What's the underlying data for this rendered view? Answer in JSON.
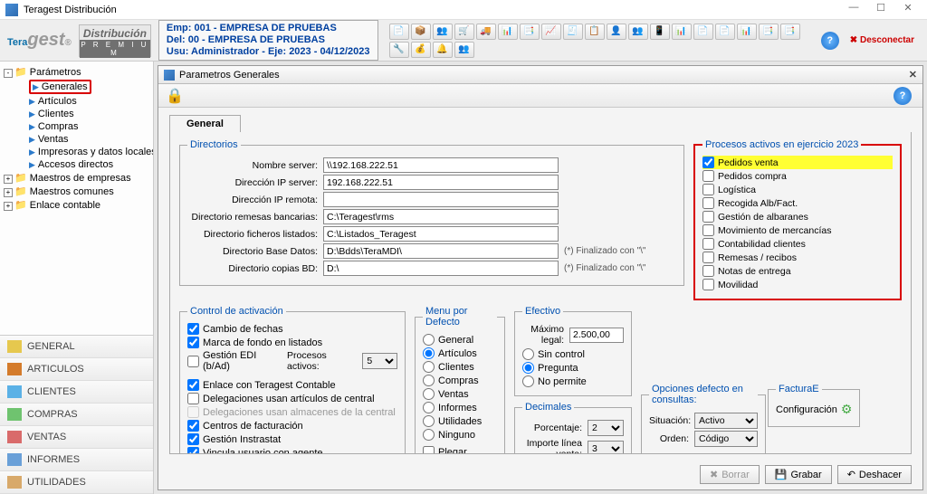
{
  "window": {
    "title": "Teragest Distribución"
  },
  "brand": {
    "main": "Tera",
    "suffix": "gest",
    "reg": "®",
    "dist": "Distribución",
    "premium": "P R E M I U M"
  },
  "info": {
    "emp": "Emp:  001 - EMPRESA DE PRUEBAS",
    "del": "Del:   00 - EMPRESA DE PRUEBAS",
    "usu": "Usu:  Administrador  - Eje:  2023 - 04/12/2023"
  },
  "disconnect": "Desconectar",
  "tree": {
    "root": "Parámetros",
    "children": [
      "Generales",
      "Artículos",
      "Clientes",
      "Compras",
      "Ventas",
      "Impresoras y datos locales",
      "Accesos directos"
    ],
    "sib1": "Maestros de empresas",
    "sib2": "Maestros comunes",
    "sib3": "Enlace contable"
  },
  "nav": [
    "GENERAL",
    "ARTICULOS",
    "CLIENTES",
    "COMPRAS",
    "VENTAS",
    "INFORMES",
    "UTILIDADES"
  ],
  "panel": {
    "title": "Parametros Generales",
    "tab": "General"
  },
  "dirs": {
    "legend": "Directorios",
    "labels": {
      "server": "Nombre server:",
      "ipserver": "Dirección IP server:",
      "ipremota": "Dirección IP remota:",
      "remesas": "Directorio remesas bancarias:",
      "listados": "Directorio ficheros listados:",
      "basedatos": "Directorio Base Datos:",
      "copias": "Directorio copias BD:"
    },
    "values": {
      "server": "\\\\192.168.222.51",
      "ipserver": "192.168.222.51",
      "ipremota": "",
      "remesas": "C:\\Teragest\\rms",
      "listados": "C:\\Listados_Teragest",
      "basedatos": "D:\\Bdds\\TeraMDI\\",
      "copias": "D:\\"
    },
    "suffix": "(*) Finalizado con \"\\\""
  },
  "control": {
    "legend": "Control de activación",
    "items": [
      "Cambio de fechas",
      "Marca de fondo en listados",
      "Gestión EDI   (b/Ad)",
      "Enlace con Teragest Contable",
      "Delegaciones usan artículos de central",
      "Delegaciones usan almacenes de la central",
      "Centros de facturación",
      "Gestión Instrastat",
      "Vincula usuario con agente"
    ],
    "checked": [
      true,
      true,
      false,
      true,
      false,
      false,
      true,
      true,
      true
    ],
    "disabledIdx": 5,
    "procesos_label": "Procesos activos:",
    "procesos_value": "5"
  },
  "menu": {
    "legend": "Menu por Defecto",
    "items": [
      "General",
      "Artículos",
      "Clientes",
      "Compras",
      "Ventas",
      "Informes",
      "Utilidades",
      "Ninguno"
    ],
    "selected": 1,
    "plegar": "Plegar"
  },
  "efectivo": {
    "legend": "Efectivo",
    "maxlabel": "Máximo legal:",
    "maxvalue": "2.500,00",
    "opts": [
      "Sin control",
      "Pregunta",
      "No permite"
    ],
    "selected": 1
  },
  "decimales": {
    "legend": "Decimales",
    "porcentaje_label": "Porcentaje:",
    "porcentaje": "2",
    "importe_label": "Importe línea venta:",
    "importe": "3"
  },
  "consultas": {
    "legend": "Opciones defecto en consultas:",
    "situacion_label": "Situación:",
    "situacion": "Activo",
    "orden_label": "Orden:",
    "orden": "Código"
  },
  "facturae": {
    "legend": "FacturaE",
    "btn": "Configuración"
  },
  "procesos": {
    "legend": "Procesos activos en ejercicio 2023",
    "items": [
      "Pedidos venta",
      "Pedidos compra",
      "Logística",
      "Recogida Alb/Fact.",
      "Gestión de albaranes",
      "Movimiento de mercancías",
      "Contabilidad clientes",
      "Remesas / recibos",
      "Notas de entrega",
      "Movilidad"
    ]
  },
  "buttons": {
    "borrar": "Borrar",
    "grabar": "Grabar",
    "deshacer": "Deshacer"
  }
}
